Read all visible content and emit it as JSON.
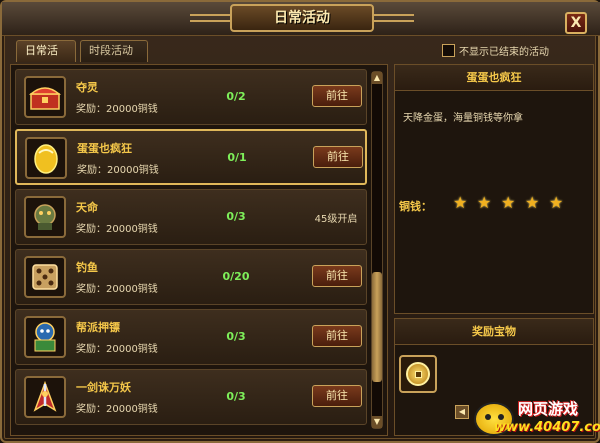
{
  "window": {
    "title": "日常活动",
    "close_label": "X"
  },
  "tabs": [
    {
      "label": "日常活动",
      "active": true
    },
    {
      "label": "时段活动",
      "active": false
    }
  ],
  "filter": {
    "hide_ended_label": "不显示已结束的活动",
    "hide_ended_checked": false
  },
  "activities": [
    {
      "name": "夺灵",
      "reward": "奖励：20000铜钱",
      "progress": "0/2",
      "action": "前往",
      "status": "",
      "icon": "treasure-chest-icon",
      "selected": false
    },
    {
      "name": "蛋蛋也疯狂",
      "reward": "奖励：20000铜钱",
      "progress": "0/1",
      "action": "前往",
      "status": "",
      "icon": "golden-egg-icon",
      "selected": true
    },
    {
      "name": "天命",
      "reward": "奖励：20000铜钱",
      "progress": "0/3",
      "action": "",
      "status": "45级开启",
      "icon": "bronze-idol-icon",
      "selected": false
    },
    {
      "name": "钓鱼",
      "reward": "奖励：20000铜钱",
      "progress": "0/20",
      "action": "前往",
      "status": "",
      "icon": "dice-icon",
      "selected": false
    },
    {
      "name": "帮派押镖",
      "reward": "奖励：20000铜钱",
      "progress": "0/3",
      "action": "前往",
      "status": "",
      "icon": "escort-banner-icon",
      "selected": false
    },
    {
      "name": "一剑诛万妖",
      "reward": "奖励：20000铜钱",
      "progress": "0/3",
      "action": "前往",
      "status": "",
      "icon": "sword-warrior-icon",
      "selected": false
    }
  ],
  "detail": {
    "title": "蛋蛋也疯狂",
    "description": "天降金蛋，海量铜钱等你拿",
    "copper_label": "铜钱：",
    "copper_stars": 5
  },
  "rewards": {
    "title": "奖励宝物",
    "items": [
      {
        "icon": "copper-coin-icon"
      }
    ]
  },
  "watermark": {
    "site_name": "网页游戏",
    "url": "www.40407.com"
  },
  "colors": {
    "accent_gold": "#c9a25a",
    "progress_green": "#7ef05a",
    "name_gold": "#f5c84a"
  }
}
